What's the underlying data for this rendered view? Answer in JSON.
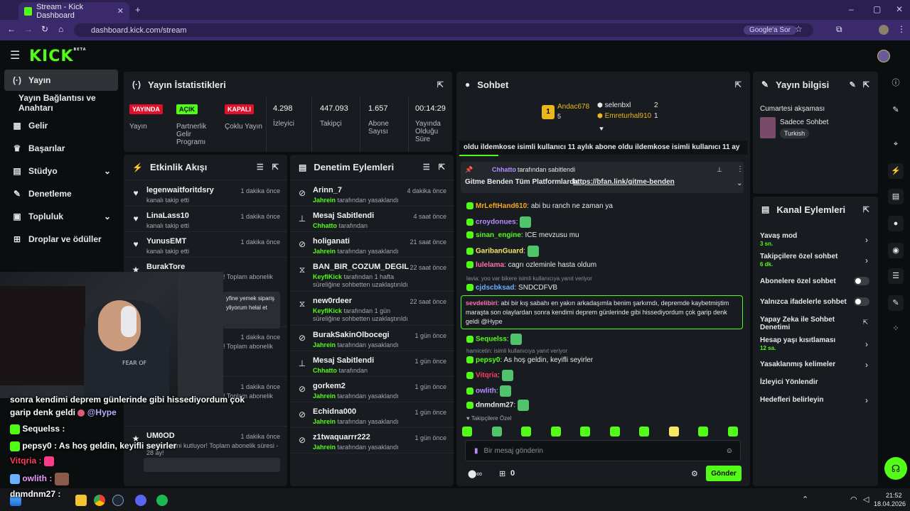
{
  "browser": {
    "tab_title": "Stream - Kick Dashboard",
    "url": "dashboard.kick.com/stream",
    "google_btn": "Google'a Sor"
  },
  "kick": {
    "logo": "KICK",
    "logo_sup": "BETA"
  },
  "nav": [
    {
      "label": "Yayın",
      "icon": "broadcast-icon"
    },
    {
      "label": "Yayın Bağlantısı ve Anahtarı",
      "icon": ""
    },
    {
      "label": "Gelir",
      "icon": "revenue-icon"
    },
    {
      "label": "Başarılar",
      "icon": "trophy-icon"
    },
    {
      "label": "Stüdyo",
      "icon": "studio-icon"
    },
    {
      "label": "Denetleme",
      "icon": "wrench-icon"
    },
    {
      "label": "Topluluk",
      "icon": "community-icon"
    },
    {
      "label": "Droplar ve ödüller",
      "icon": "drops-icon"
    }
  ],
  "stats": {
    "title": "Yayın İstatistikleri",
    "items": [
      {
        "badge": "YAYINDA",
        "label": "Yayın"
      },
      {
        "badge": "AÇIK",
        "label": "Partnerlik Gelir Programı"
      },
      {
        "badge": "KAPALI",
        "label": "Çoklu Yayın"
      },
      {
        "value": "4.298",
        "label": "İzleyici"
      },
      {
        "value": "447.093",
        "label": "Takipçi"
      },
      {
        "value": "1.657",
        "label": "Abone Sayısı"
      },
      {
        "value": "00:14:29",
        "label": "Yayında Olduğu Süre"
      }
    ]
  },
  "activity": {
    "title": "Etkinlik Akışı",
    "rows": [
      {
        "name": "legenwaitforitdsry",
        "desc": "kanalı takip etti",
        "time": "1 dakika önce"
      },
      {
        "name": "LinaLass10",
        "desc": "kanalı takip etti",
        "time": "1 dakika önce"
      },
      {
        "name": "YunusEMT",
        "desc": "kanalı takip etti",
        "time": "1 dakika önce"
      },
      {
        "name": "BurakTore",
        "desc": "! Toplam abonelik",
        "time": ""
      },
      {
        "name": "",
        "desc": "! Toplam abonelik",
        "time": "1 dakika önce"
      },
      {
        "name": "",
        "desc": "! Toplam abonelik",
        "time": "1 dakika önce"
      },
      {
        "name": "UM0OD",
        "desc": "yenilemesini kutluyor! Toplam abonelik süresi - 28 ay!",
        "time": "1 dakika önce"
      }
    ],
    "snippet": "yfine yemek sipariş yliyorum helal et"
  },
  "moderation": {
    "title": "Denetim Eylemleri",
    "rows": [
      {
        "name": "Arinn_7",
        "by": "Jahrein",
        "desc": "tarafından yasaklandı",
        "time": "4 dakika önce",
        "icon": "ban-icon"
      },
      {
        "name": "Mesaj Sabitlendi",
        "by": "Chhatto",
        "desc": "tarafından",
        "time": "4 saat önce",
        "icon": "pin-icon"
      },
      {
        "name": "holiganati",
        "by": "Jahrein",
        "desc": "tarafından yasaklandı",
        "time": "21 saat önce",
        "icon": "ban-icon"
      },
      {
        "name": "BAN_BIR_COZUM_DEGIL",
        "by": "KeyfiKick",
        "desc": "tarafından 1 hafta süreliğine sohbetten uzaklaştırıldı",
        "time": "22 saat önce",
        "icon": "hourglass-icon"
      },
      {
        "name": "new0rdeer",
        "by": "KeyfiKick",
        "desc": "tarafından 1 gün süreliğine sohbetten uzaklaştırıldı",
        "time": "22 saat önce",
        "icon": "hourglass-icon"
      },
      {
        "name": "BurakSakinOlbocegi",
        "by": "Jahrein",
        "desc": "tarafından yasaklandı",
        "time": "1 gün önce",
        "icon": "ban-icon"
      },
      {
        "name": "Mesaj Sabitlendi",
        "by": "Chhatto",
        "desc": "tarafından",
        "time": "1 gün önce",
        "icon": "pin-icon"
      },
      {
        "name": "gorkem2",
        "by": "Jahrein",
        "desc": "tarafından yasaklandı",
        "time": "1 gün önce",
        "icon": "ban-icon"
      },
      {
        "name": "Echidna000",
        "by": "Jahrein",
        "desc": "tarafından yasaklandı",
        "time": "1 gün önce",
        "icon": "ban-icon"
      },
      {
        "name": "z1twaquarrr222",
        "by": "Jahrein",
        "desc": "tarafından yasaklandı",
        "time": "1 gün önce",
        "icon": "ban-icon"
      }
    ]
  },
  "chat": {
    "title": "Sohbet",
    "leaders": [
      {
        "rank": "1",
        "name": "Andac678",
        "count": "5"
      },
      {
        "name": "selenbxl",
        "count": "2"
      },
      {
        "name": "Emreturhal910",
        "count": "1"
      }
    ],
    "ticker": "oldu  ildemkose isimli kullanıcı 11 aylık abone oldu  ildemkose isimli kullanıcı 11 ay",
    "pinned_by": "Chhatto",
    "pinned_suffix": "tarafından sabitlendi",
    "pinned_text": "Gitme Benden Tüm Platformlarda:",
    "pinned_link": "https://bfan.link/gitme-benden",
    "messages": [
      {
        "user": "MrLeftHand610",
        "color": "#f5a623",
        "text": "abi bu ranch ne zaman ya"
      },
      {
        "user": "croydonues",
        "color": "#b48cff",
        "text": ""
      },
      {
        "user": "sinan_engine",
        "color": "#53fc18",
        "text": "ICE mevzusu mu"
      },
      {
        "user": "GaribanGuard",
        "color": "#f5e663",
        "text": ""
      },
      {
        "user": "lulelama",
        "color": "#ff6fb1",
        "text": "cagrı ozleminle hasta oldum"
      },
      {
        "user": "",
        "color": "#8a8f94",
        "text": "lavia: yoo var bikere isimli kullanıcıya yanıt veriyor"
      },
      {
        "user": "cjdscbksad",
        "color": "#6ab0ff",
        "text": "SNDCDFVB"
      }
    ],
    "highlight_user": "sevdelibiri",
    "highlight_text": "abi bir kış sabahı en yakın arkadaşımla benim şarkımdı, depremde kaybetmiştim maraşta son olaylardan sonra kendimi deprem günlerinde gibi hissediyordum çok garip denk geldi",
    "highlight_tail": "@Hype",
    "messages2": [
      {
        "user": "Sequelss",
        "color": "#53fc18",
        "text": ""
      },
      {
        "user": "",
        "color": "#8a8f94",
        "text": "hamicetin: isimli kullanıcıya yanıt veriyor"
      },
      {
        "user": "pepsy0",
        "color": "#53fc18",
        "text": "As hoş geldin, keyifli seyirler"
      },
      {
        "user": "Vitqria",
        "color": "#ff3b5c",
        "text": ""
      },
      {
        "user": "owlith",
        "color": "#b48cff",
        "text": ""
      },
      {
        "user": "dnmdnm27",
        "color": "#e6e8ea",
        "text": ""
      }
    ],
    "followers_only": "Takipçilere Özel",
    "input_placeholder": "Bir mesaj gönderin",
    "count": "0",
    "send": "Gönder"
  },
  "stream_info": {
    "title": "Yayın bilgisi",
    "stream_title": "Cumartesi akşaması",
    "category": "Sadece Sohbet",
    "tag": "Turkish"
  },
  "channel_actions": {
    "title": "Kanal Eylemleri",
    "items": [
      {
        "label": "Yavaş mod",
        "sub": "3 sn.",
        "control": "chevron"
      },
      {
        "label": "Takipçilere özel sohbet",
        "sub": "6 dk.",
        "control": "chevron"
      },
      {
        "label": "Abonelere özel sohbet",
        "sub": "",
        "control": "toggle"
      },
      {
        "label": "Yalnızca ifadelerle sohbet",
        "sub": "",
        "control": "toggle"
      },
      {
        "label": "Yapay Zeka ile Sohbet Denetimi",
        "sub": "",
        "control": "external"
      },
      {
        "label": "Hesap yaşı kısıtlaması",
        "sub": "12 sa.",
        "control": "chevron"
      },
      {
        "label": "Yasaklanmış kelimeler",
        "sub": "",
        "control": "chevron"
      },
      {
        "label": "İzleyici Yönlendir",
        "sub": "",
        "control": "none"
      },
      {
        "label": "Hedefleri belirleyin",
        "sub": "",
        "control": "chevron"
      }
    ]
  },
  "overlay": {
    "line1": "sonra kendimi deprem günlerinde gibi hissediyordum çok",
    "line2": "garip denk geldi",
    "line2_tail": "@Hype",
    "u1": "Sequelss :",
    "u2": "pepsy0 : As hoş geldin, keyifli seyirler",
    "u3": "Vitqria :",
    "u4": "owlith :",
    "u5": "dnmdnm27 :",
    "shirt": "FEAR OF"
  },
  "taskbar": {
    "time": "21:52",
    "date": "18.04.2026"
  },
  "colors": {
    "accent": "#53fc18",
    "panel": "#181b1f",
    "bg": "#0b0e0f",
    "browser": "#3a2a6b",
    "live_red": "#e0102b"
  }
}
